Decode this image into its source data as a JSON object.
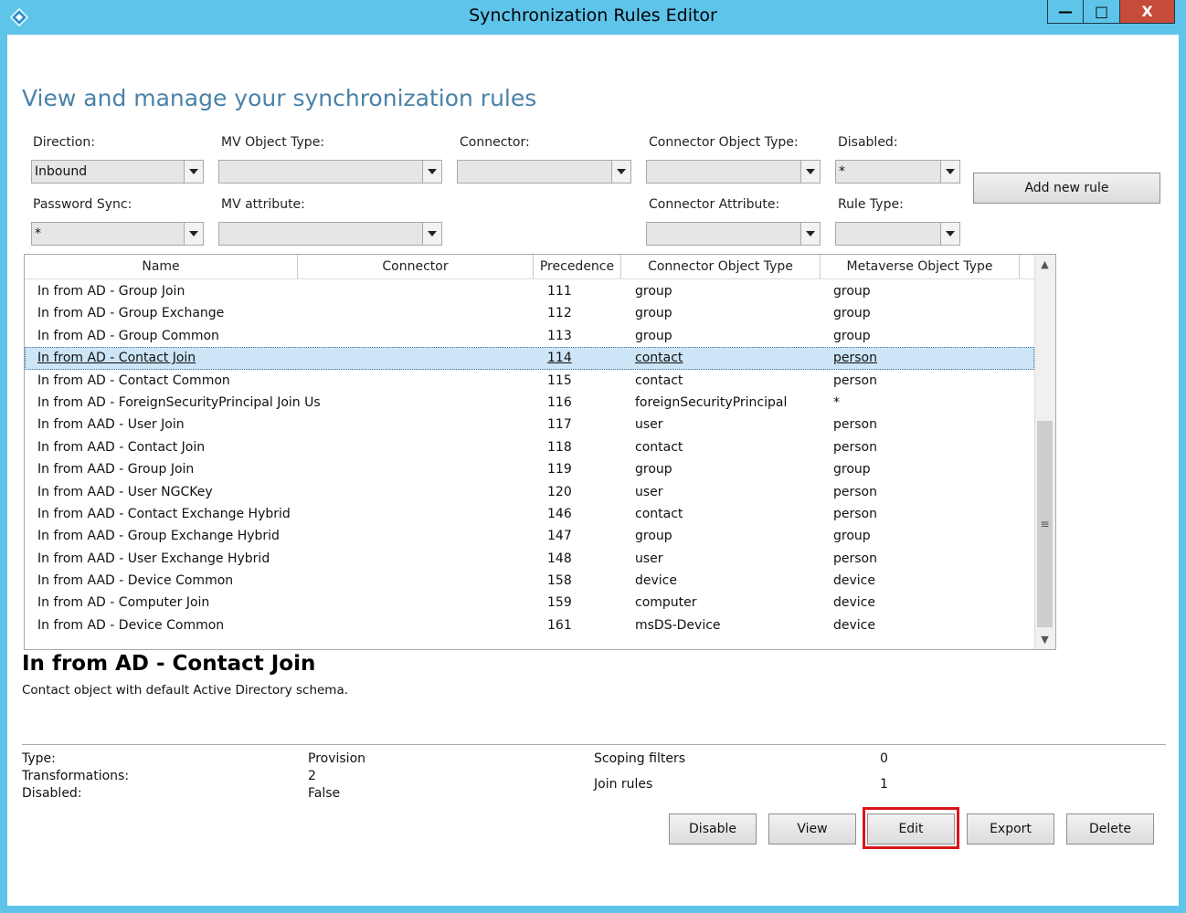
{
  "window": {
    "title": "Synchronization Rules Editor",
    "controls": {
      "minimize": "—",
      "maximize": "□",
      "close": "X"
    }
  },
  "heading": "View and manage your synchronization rules",
  "filters": {
    "direction": {
      "label": "Direction:",
      "value": "Inbound"
    },
    "mv_object_type": {
      "label": "MV Object Type:",
      "value": ""
    },
    "connector": {
      "label": "Connector:",
      "value": ""
    },
    "connector_object_type": {
      "label": "Connector Object Type:",
      "value": ""
    },
    "disabled": {
      "label": "Disabled:",
      "value": "*"
    },
    "password_sync": {
      "label": "Password Sync:",
      "value": "*"
    },
    "mv_attribute": {
      "label": "MV attribute:",
      "value": ""
    },
    "connector_attribute": {
      "label": "Connector Attribute:",
      "value": ""
    },
    "rule_type": {
      "label": "Rule Type:",
      "value": ""
    }
  },
  "add_rule_label": "Add new rule",
  "grid": {
    "columns": [
      "Name",
      "Connector",
      "Precedence",
      "Connector Object Type",
      "Metaverse Object Type"
    ],
    "selected_index": 3,
    "rows": [
      {
        "name": "In from AD - Group Join",
        "connector": "",
        "precedence": "111",
        "cot": "group",
        "mot": "group"
      },
      {
        "name": "In from AD - Group Exchange",
        "connector": "",
        "precedence": "112",
        "cot": "group",
        "mot": "group"
      },
      {
        "name": "In from AD - Group Common",
        "connector": "",
        "precedence": "113",
        "cot": "group",
        "mot": "group"
      },
      {
        "name": "In from AD - Contact Join",
        "connector": "",
        "precedence": "114",
        "cot": "contact",
        "mot": "person"
      },
      {
        "name": "In from AD - Contact Common",
        "connector": "",
        "precedence": "115",
        "cot": "contact",
        "mot": "person"
      },
      {
        "name": "In from AD - ForeignSecurityPrincipal Join Us",
        "connector": "",
        "precedence": "116",
        "cot": "foreignSecurityPrincipal",
        "mot": "*"
      },
      {
        "name": "In from AAD - User Join",
        "connector": "",
        "precedence": "117",
        "cot": "user",
        "mot": "person"
      },
      {
        "name": "In from AAD - Contact Join",
        "connector": "",
        "precedence": "118",
        "cot": "contact",
        "mot": "person"
      },
      {
        "name": "In from AAD - Group Join",
        "connector": "",
        "precedence": "119",
        "cot": "group",
        "mot": "group"
      },
      {
        "name": "In from AAD - User NGCKey",
        "connector": "",
        "precedence": "120",
        "cot": "user",
        "mot": "person"
      },
      {
        "name": "In from AAD - Contact Exchange Hybrid",
        "connector": "",
        "precedence": "146",
        "cot": "contact",
        "mot": "person"
      },
      {
        "name": "In from AAD - Group Exchange Hybrid",
        "connector": "",
        "precedence": "147",
        "cot": "group",
        "mot": "group"
      },
      {
        "name": "In from AAD - User Exchange Hybrid",
        "connector": "",
        "precedence": "148",
        "cot": "user",
        "mot": "person"
      },
      {
        "name": "In from AAD - Device Common",
        "connector": "",
        "precedence": "158",
        "cot": "device",
        "mot": "device"
      },
      {
        "name": "In from AD - Computer Join",
        "connector": "",
        "precedence": "159",
        "cot": "computer",
        "mot": "device"
      },
      {
        "name": "In from AD - Device Common",
        "connector": "",
        "precedence": "161",
        "cot": "msDS-Device",
        "mot": "device"
      }
    ]
  },
  "detail": {
    "title": "In from AD - Contact Join",
    "description": "Contact object with default Active Directory schema.",
    "type_label": "Type:",
    "type_value": "Provision",
    "transformations_label": "Transformations:",
    "transformations_value": "2",
    "disabled_label": "Disabled:",
    "disabled_value": "False",
    "scoping_label": "Scoping filters",
    "scoping_value": "0",
    "join_label": "Join rules",
    "join_value": "1"
  },
  "actions": {
    "disable": "Disable",
    "view": "View",
    "edit": "Edit",
    "export": "Export",
    "delete": "Delete"
  },
  "colors": {
    "title_bar": "#5fc4ea",
    "heading": "#4a82a8",
    "selection": "#cde6f7",
    "highlight": "#d9151b"
  }
}
